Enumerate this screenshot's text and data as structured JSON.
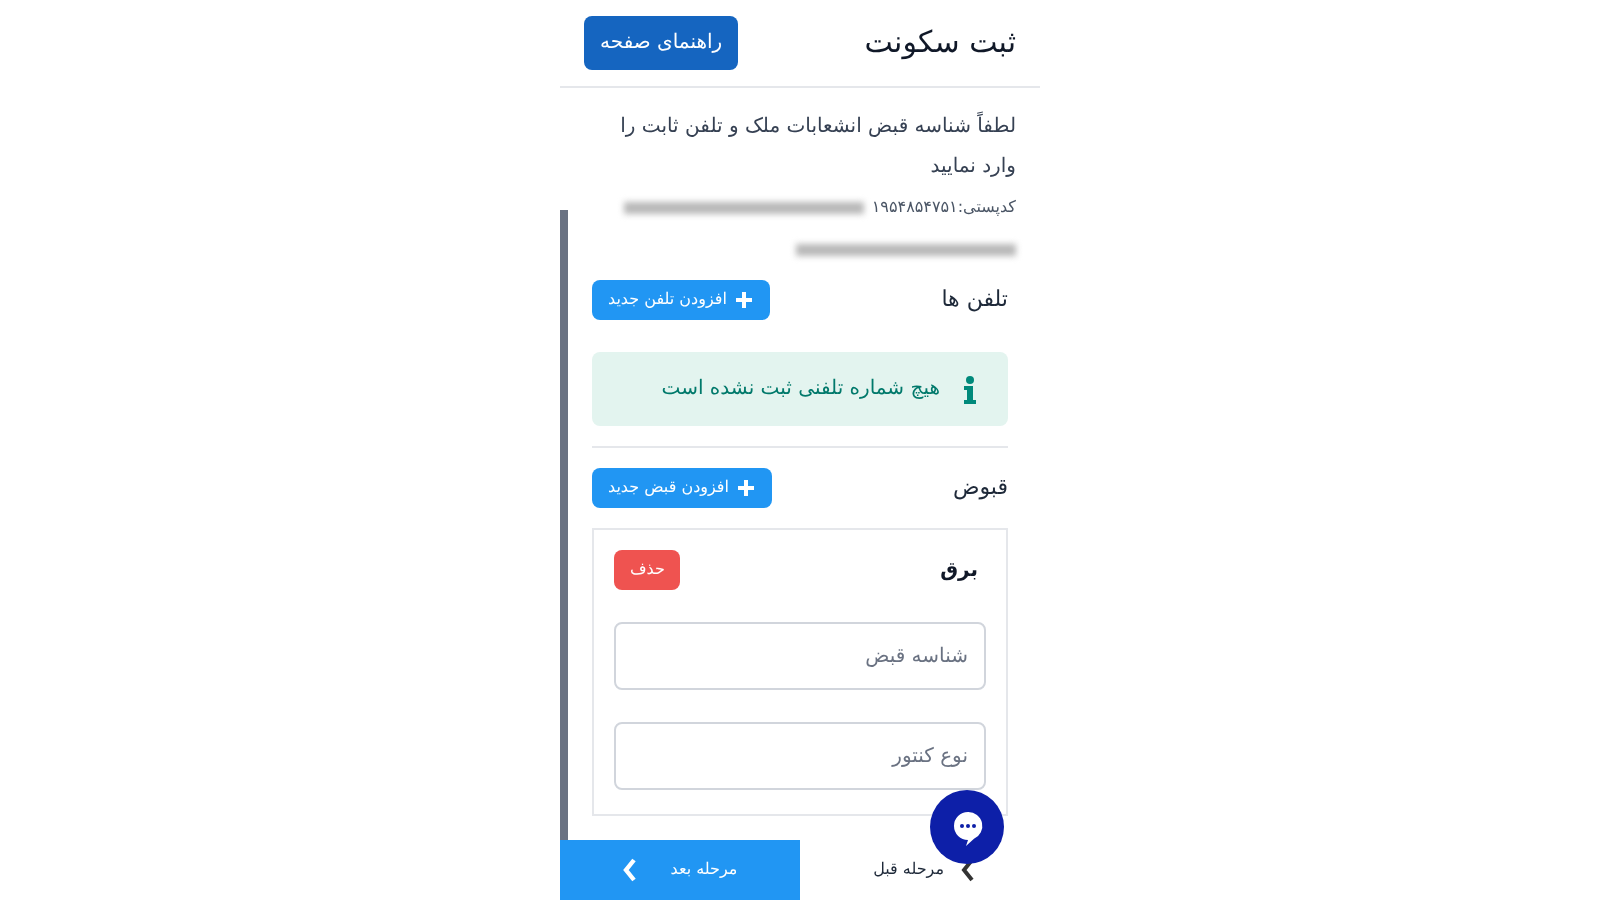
{
  "header": {
    "title": "ثبت سکونت",
    "help_button": "راهنمای صفحه"
  },
  "instructions": "لطفاً شناسه قبض انشعابات ملک و تلفن ثابت را وارد نمایید",
  "address": {
    "postal_code": "کدپستی:۱۹۵۴۸۵۴۷۵۱"
  },
  "phones": {
    "title": "تلفن ها",
    "add_button": "افزودن تلفن جدید",
    "alert": "هیچ شماره تلفنی ثبت نشده است"
  },
  "bills": {
    "title": "قبوض",
    "add_button": "افزودن قبض جدید",
    "items": [
      {
        "title": "برق",
        "delete_button": "حذف",
        "fields": [
          {
            "placeholder": "شناسه قبض"
          },
          {
            "placeholder": "نوع کنتور"
          }
        ]
      }
    ]
  },
  "footer": {
    "next": "مرحله بعد",
    "previous": "مرحله قبل"
  }
}
